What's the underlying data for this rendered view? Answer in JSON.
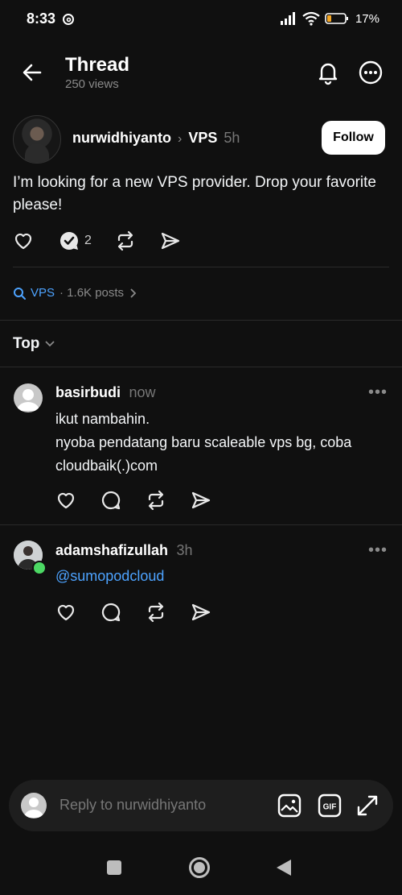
{
  "status_bar": {
    "time": "8:33",
    "battery": "17%"
  },
  "header": {
    "title": "Thread",
    "views": "250 views"
  },
  "post": {
    "author": "nurwidhiyanto",
    "topic": "VPS",
    "age": "5h",
    "follow_label": "Follow",
    "text": "I’m looking for a new VPS provider. Drop your favorite please!",
    "reply_count": "2"
  },
  "topic_tag": {
    "name": "VPS",
    "count": "· 1.6K posts"
  },
  "sort": {
    "label": "Top"
  },
  "replies": [
    {
      "author": "basirbudi",
      "time": "now",
      "text_line1": "ikut nambahin.",
      "text_line2": "nyoba pendatang baru scaleable vps bg, coba cloudbaik(.)com"
    },
    {
      "author": "adamshafizullah",
      "time": "3h",
      "text": "@sumopodcloud"
    }
  ],
  "composer": {
    "placeholder": "Reply to nurwidhiyanto"
  },
  "icons": {
    "header": [
      "back-arrow-icon",
      "bell-icon",
      "more-icon"
    ],
    "actions": [
      "heart-icon",
      "reply-icon",
      "repost-icon",
      "share-icon"
    ],
    "composer": [
      "image-icon",
      "gif-icon",
      "expand-icon"
    ],
    "nav": [
      "recents-icon",
      "home-icon",
      "back-icon"
    ]
  },
  "colors": {
    "background": "#101010",
    "link": "#4da3ff",
    "online": "#4cd964"
  }
}
